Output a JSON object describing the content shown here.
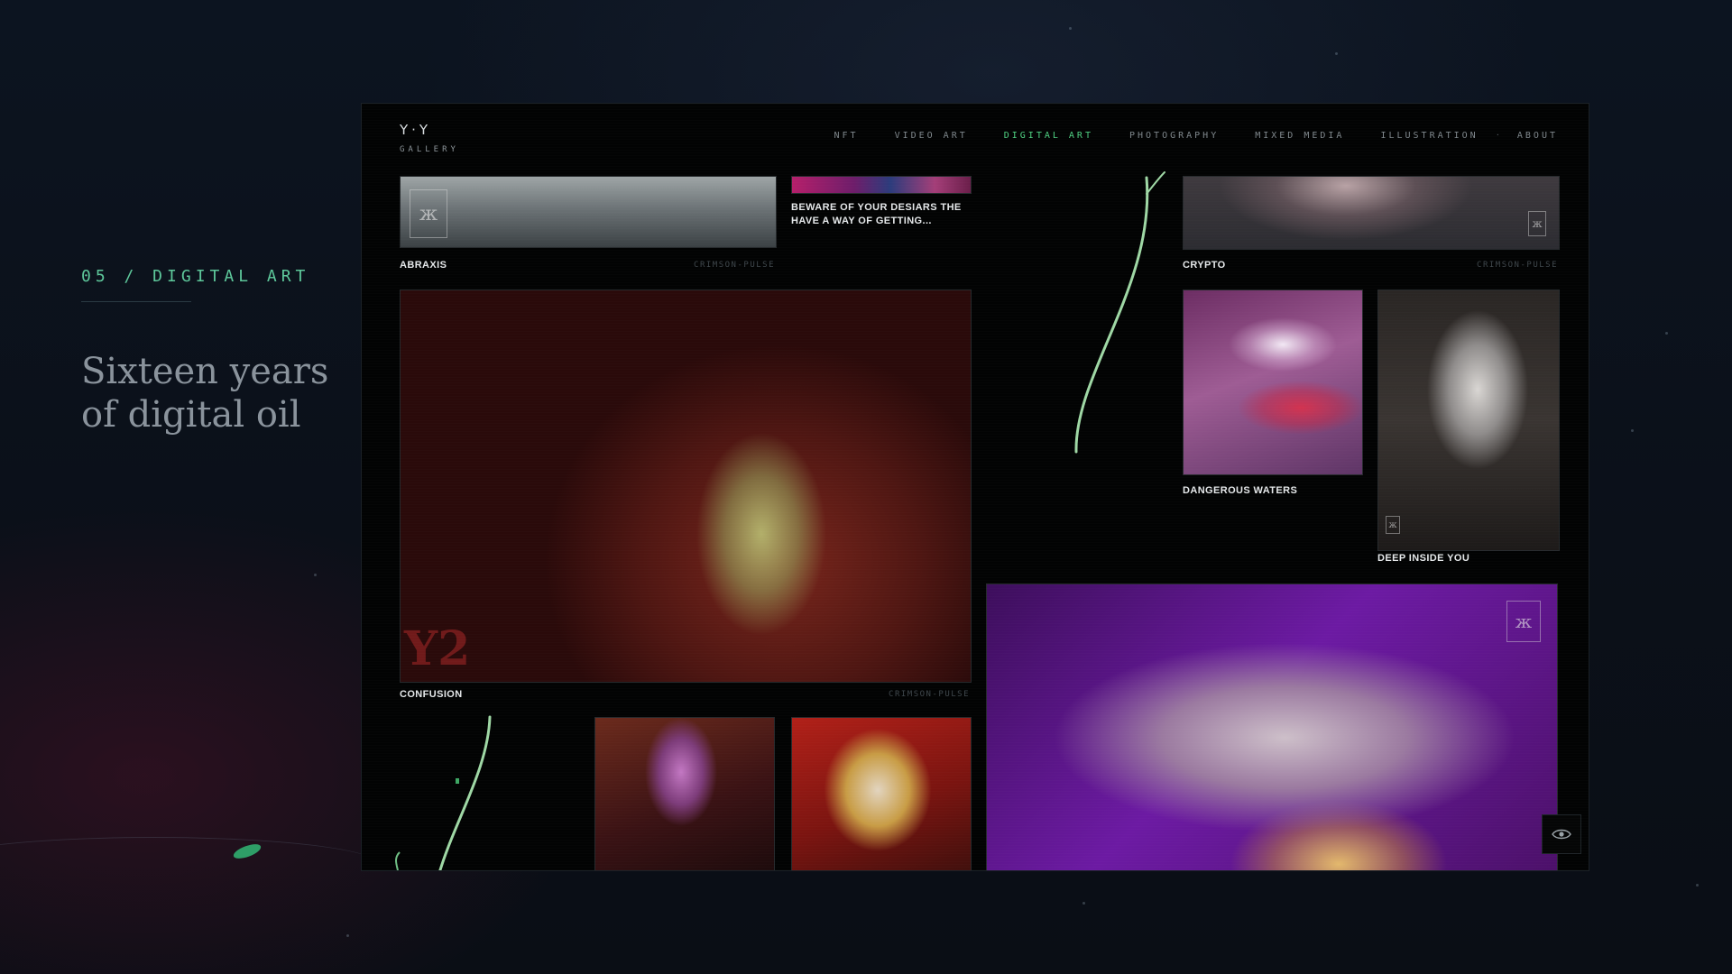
{
  "intro": {
    "section_label": "05 / DIGITAL ART",
    "heading": "Sixteen years of digital oil"
  },
  "window": {
    "logo": {
      "mark": "Y·Y",
      "sub": "GALLERY"
    },
    "nav": {
      "items": [
        {
          "label": "NFT",
          "active": false
        },
        {
          "label": "VIDEO ART",
          "active": false
        },
        {
          "label": "DIGITAL ART",
          "active": true
        },
        {
          "label": "PHOTOGRAPHY",
          "active": false
        },
        {
          "label": "MIXED MEDIA",
          "active": false
        },
        {
          "label": "ILLUSTRATION",
          "active": false
        },
        {
          "label": "ABOUT",
          "active": false
        }
      ],
      "separator": "·",
      "active_color": "#4fd082"
    },
    "artworks": [
      {
        "title": "ABRAXIS",
        "tag": "CRIMSON-PULSE"
      },
      {
        "title": "BEWARE OF YOUR DESIARS THE HAVE A WAY OF GETTING...",
        "tag": ""
      },
      {
        "title": "CRYPTO",
        "tag": "CRIMSON-PULSE"
      },
      {
        "title": "CONFUSION",
        "tag": "CRIMSON-PULSE"
      },
      {
        "title": "DANGEROUS WATERS",
        "tag": ""
      },
      {
        "title": "DEEP INSIDE YOU",
        "tag": ""
      },
      {
        "title": "",
        "tag": ""
      },
      {
        "title": "",
        "tag": ""
      },
      {
        "title": "",
        "tag": ""
      }
    ],
    "watermark": "Y2",
    "eye_icon": "eye-icon"
  },
  "accent_colors": {
    "green": "#4fd082",
    "vine": "#9fd8a5"
  }
}
